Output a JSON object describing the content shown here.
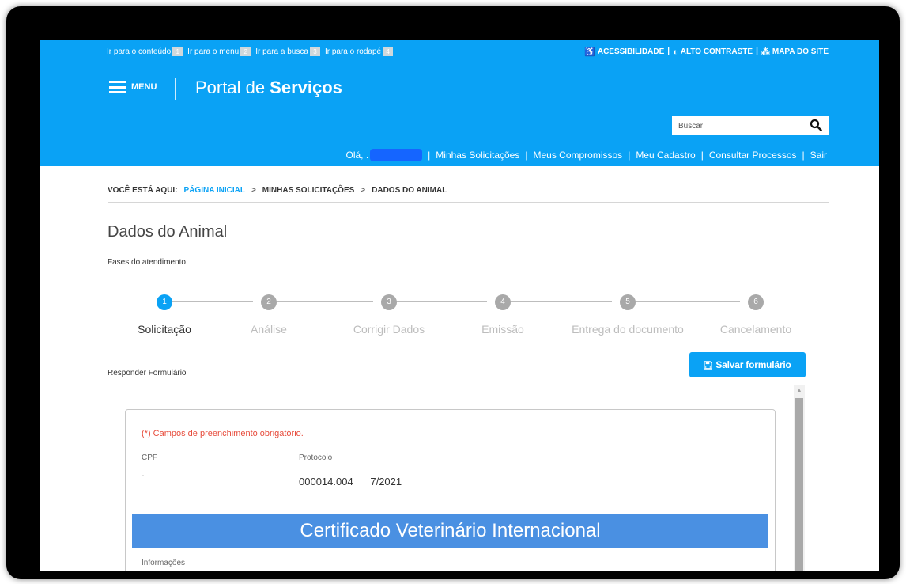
{
  "skip_links": [
    {
      "label": "Ir para o conteúdo",
      "key": "1"
    },
    {
      "label": "Ir para o menu",
      "key": "2"
    },
    {
      "label": "Ir para a busca",
      "key": "3"
    },
    {
      "label": "Ir para o rodapé",
      "key": "4"
    }
  ],
  "utility": {
    "accessibility": "ACESSIBILIDADE",
    "contrast": "ALTO CONTRASTE",
    "sitemap": "MAPA DO SITE"
  },
  "header": {
    "menu_label": "MENU",
    "portal_title_regular": "Portal de ",
    "portal_title_bold": "Serviços",
    "search_placeholder": "Buscar"
  },
  "user_nav": {
    "greeting": "Olá, .",
    "links": [
      "Minhas Solicitações",
      "Meus Compromissos",
      "Meu Cadastro",
      "Consultar Processos",
      "Sair"
    ]
  },
  "breadcrumb": {
    "prefix": "VOCÊ ESTÁ AQUI:",
    "items": [
      "PÁGINA INICIAL",
      "MINHAS SOLICITAÇÕES",
      "DADOS DO ANIMAL"
    ]
  },
  "page": {
    "title": "Dados do Animal",
    "phases_label": "Fases do atendimento",
    "respond_label": "Responder Formulário",
    "save_button": "Salvar formulário"
  },
  "steps": [
    {
      "number": "1",
      "label": "Solicitação",
      "active": true
    },
    {
      "number": "2",
      "label": "Análise",
      "active": false
    },
    {
      "number": "3",
      "label": "Corrigir Dados",
      "active": false
    },
    {
      "number": "4",
      "label": "Emissão",
      "active": false
    },
    {
      "number": "5",
      "label": "Entrega do documento",
      "active": false
    },
    {
      "number": "6",
      "label": "Cancelamento",
      "active": false
    }
  ],
  "form": {
    "required_note": "(*) Campos de preenchimento obrigatório.",
    "cpf_label": "CPF",
    "cpf_value": "-",
    "protocol_label": "Protocolo",
    "protocol_value": "000014.004      7/2021",
    "banner": "Certificado Veterinário Internacional",
    "info_label": "Informações"
  },
  "colors": {
    "primary": "#0aa2f5",
    "banner": "#4a90e2",
    "required": "#e74c3c"
  }
}
